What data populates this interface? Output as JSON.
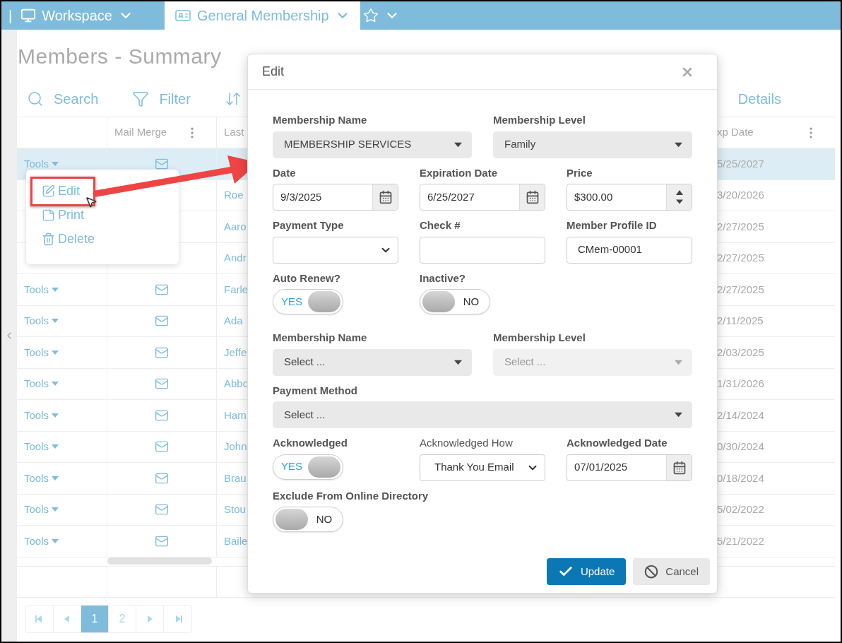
{
  "top_bar": {
    "separator": "|",
    "tabs": [
      {
        "kind": "monitor",
        "label": "Workspace",
        "selected": false
      },
      {
        "kind": "card",
        "label": "General Membership",
        "selected": true
      },
      {
        "kind": "star",
        "selected": false
      }
    ]
  },
  "page": {
    "title": "Members - Summary",
    "toolbar": [
      {
        "kind": "search",
        "label": "Search"
      },
      {
        "kind": "filter",
        "label": "Filter"
      },
      {
        "kind": "sort"
      },
      {
        "kind": "details",
        "label": "Details"
      }
    ]
  },
  "table": {
    "columns": [
      "Mail Merge",
      "Last",
      "xp Date"
    ],
    "rows": [
      {
        "tools": "Tools",
        "exp_date": "5/25/2027",
        "selected": true
      },
      {
        "last_name": "Roe",
        "exp_date": "3/20/2026",
        "selected": false
      },
      {
        "last_name": "Aaro",
        "exp_date": "2/27/2025",
        "selected": false
      },
      {
        "last_name": "Andr",
        "exp_date": "2/27/2025",
        "selected": false
      },
      {
        "tools": "Tools",
        "last_name": "Farle",
        "exp_date": "2/27/2025",
        "selected": false
      },
      {
        "tools": "Tools",
        "last_name": "Ada",
        "exp_date": "2/11/2025",
        "selected": false
      },
      {
        "tools": "Tools",
        "last_name": "Jeffe",
        "exp_date": "2/03/2025",
        "selected": false
      },
      {
        "tools": "Tools",
        "last_name": "Abbo",
        "exp_date": "1/31/2026",
        "selected": false
      },
      {
        "tools": "Tools",
        "last_name": "Ham",
        "exp_date": "2/14/2024",
        "selected": false
      },
      {
        "tools": "Tools",
        "last_name": "John",
        "exp_date": "0/30/2024",
        "selected": false
      },
      {
        "tools": "Tools",
        "last_name": "Brau",
        "exp_date": "0/18/2024",
        "selected": false
      },
      {
        "tools": "Tools",
        "last_name": "Stou",
        "exp_date": "5/02/2022",
        "selected": false
      },
      {
        "tools": "Tools",
        "last_name": "Baile",
        "exp_date": "5/21/2022",
        "selected": false
      }
    ]
  },
  "row_menu": {
    "items": [
      {
        "kind": "edit",
        "label": "Edit",
        "annotated": true
      },
      {
        "kind": "print",
        "label": "Print",
        "annotated": false
      },
      {
        "kind": "delete",
        "label": "Delete",
        "annotated": false
      }
    ]
  },
  "pager": {
    "pages": [
      {
        "label": "1",
        "selected": true
      },
      {
        "label": "2",
        "selected": false
      }
    ]
  },
  "dialog": {
    "title": "Edit",
    "rows": [
      [
        {
          "kind": "select",
          "label": "Membership Name",
          "value": "MEMBERSHIP SERVICES",
          "disabled": false
        },
        {
          "kind": "select",
          "label": "Membership Level",
          "value": "Family",
          "disabled": false
        }
      ],
      [
        {
          "kind": "date",
          "label": "Date",
          "value": "9/3/2025"
        },
        {
          "kind": "date",
          "label": "Expiration Date",
          "value": "6/25/2027"
        },
        {
          "kind": "number",
          "label": "Price",
          "value": "$300.00"
        }
      ],
      [
        {
          "kind": "dropdown",
          "label": "Payment Type"
        },
        {
          "kind": "text",
          "label": "Check #"
        },
        {
          "kind": "text",
          "label": "Member Profile ID",
          "value": "CMem-00001"
        }
      ],
      [
        {
          "kind": "toggle",
          "label": "Auto Renew?",
          "on": true,
          "text": "YES"
        },
        {
          "kind": "toggle",
          "label": "Inactive?",
          "on": false,
          "text": "NO"
        }
      ],
      [
        {
          "kind": "select",
          "label": "Membership Name",
          "placeholder": "Select ...",
          "disabled": false
        },
        {
          "kind": "select",
          "label": "Membership Level",
          "placeholder": "Select ...",
          "disabled": true
        }
      ],
      [
        {
          "kind": "select",
          "label": "Payment Method",
          "placeholder": "Select ...",
          "disabled": false
        }
      ],
      [
        {
          "kind": "toggle",
          "label": "Acknowledged",
          "on": true,
          "text": "YES"
        },
        {
          "kind": "dropdown",
          "label": "Acknowledged How",
          "value": "Thank You Email",
          "plain_label": true
        },
        {
          "kind": "date",
          "label": "Acknowledged Date",
          "value": "07/01/2025"
        }
      ],
      [
        {
          "kind": "toggle",
          "label": "Exclude From Online Directory",
          "on": false,
          "text": "NO"
        }
      ]
    ],
    "buttons": [
      {
        "kind": "primary",
        "label": "Update"
      },
      {
        "kind": "secondary",
        "label": "Cancel"
      }
    ]
  }
}
